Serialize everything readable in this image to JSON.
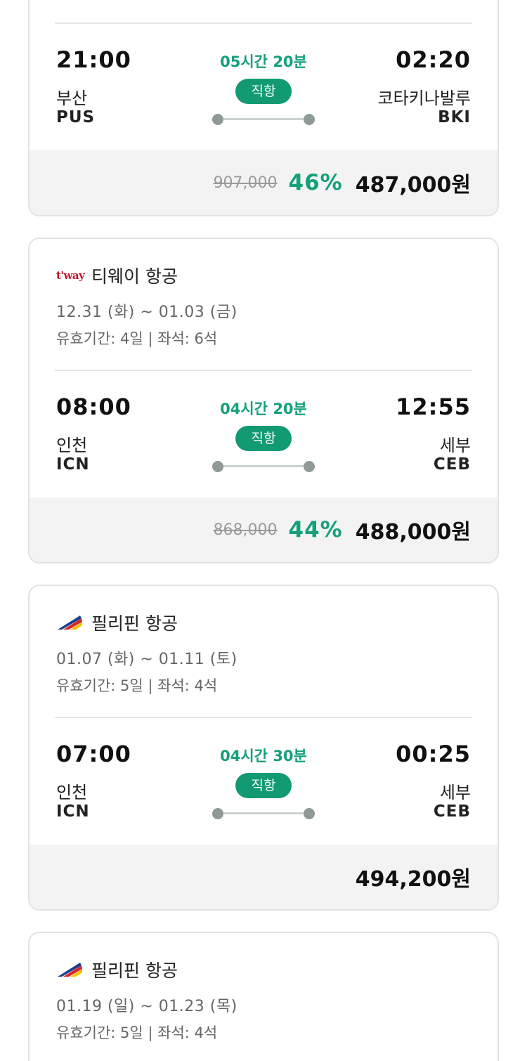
{
  "cards": [
    {
      "flight": {
        "dep_time": "21:00",
        "dep_city": "부산",
        "dep_code": "PUS",
        "duration": "05시간 20분",
        "direct": "직항",
        "arr_time": "02:20",
        "arr_city": "코타키나발루",
        "arr_code": "BKI"
      },
      "price": {
        "original": "907,000",
        "discount": "46%",
        "final": "487,000원"
      }
    },
    {
      "airline": {
        "logo_text": "t'way",
        "name": "티웨이 항공"
      },
      "dates": "12.31 (화) ~ 01.03 (금)",
      "validity": "유효기간: 4일 | 좌석: 6석",
      "flight": {
        "dep_time": "08:00",
        "dep_city": "인천",
        "dep_code": "ICN",
        "duration": "04시간 20분",
        "direct": "직항",
        "arr_time": "12:55",
        "arr_city": "세부",
        "arr_code": "CEB"
      },
      "price": {
        "original": "868,000",
        "discount": "44%",
        "final": "488,000원"
      }
    },
    {
      "airline": {
        "name": "필리핀 항공"
      },
      "dates": "01.07 (화) ~ 01.11 (토)",
      "validity": "유효기간: 5일 | 좌석: 4석",
      "flight": {
        "dep_time": "07:00",
        "dep_city": "인천",
        "dep_code": "ICN",
        "duration": "04시간 30분",
        "direct": "직항",
        "arr_time": "00:25",
        "arr_city": "세부",
        "arr_code": "CEB"
      },
      "price": {
        "final": "494,200원"
      }
    },
    {
      "airline": {
        "name": "필리핀 항공"
      },
      "dates": "01.19 (일) ~ 01.23 (목)",
      "validity": "유효기간: 5일 | 좌석: 4석"
    }
  ],
  "colors": {
    "accent": "#129b73",
    "accent_text": "#14a07a",
    "price_bg": "#f3f3f3"
  }
}
